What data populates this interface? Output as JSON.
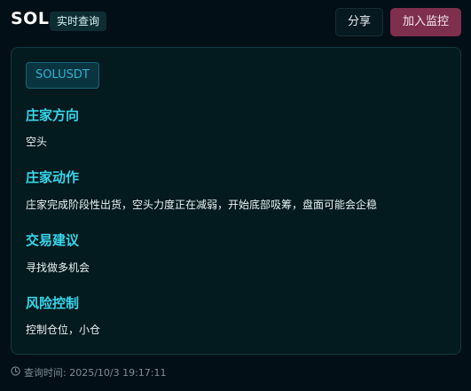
{
  "header": {
    "title": "SOL",
    "badge": "实时查询",
    "share_label": "分享",
    "monitor_label": "加入监控"
  },
  "card": {
    "symbol": "SOLUSDT",
    "sections": [
      {
        "title": "庄家方向",
        "text": "空头"
      },
      {
        "title": "庄家动作",
        "text": "庄家完成阶段性出货，空头力度正在减弱，开始底部吸筹，盘面可能会企稳"
      },
      {
        "title": "交易建议",
        "text": "寻找做多机会"
      },
      {
        "title": "风险控制",
        "text": "控制仓位，小仓"
      }
    ]
  },
  "footer": {
    "icon": "clock-icon",
    "query_time": "查询时间: 2025/10/3 19:17:11"
  },
  "colors": {
    "background": "#030f16",
    "accent_cyan": "#36d6ea",
    "monitor_button": "#7d2f4d"
  }
}
